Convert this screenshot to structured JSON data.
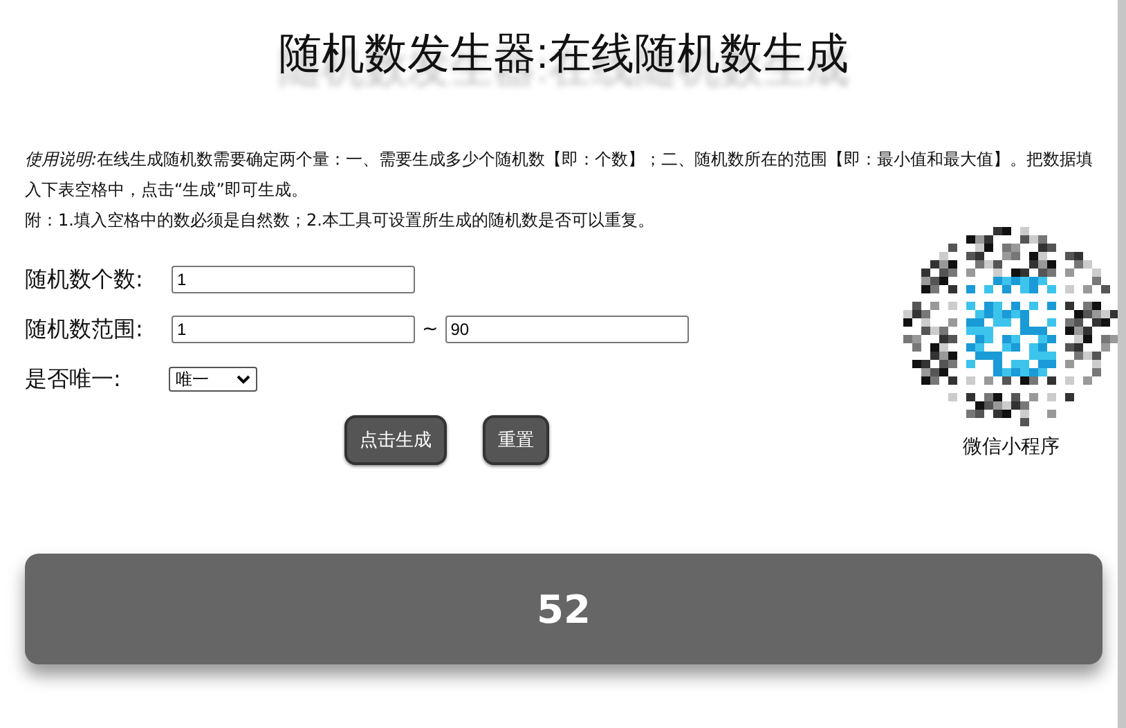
{
  "title": "随机数发生器:在线随机数生成",
  "instructions": {
    "lead": "使用说明:",
    "text": "在线生成随机数需要确定两个量：一、需要生成多少个随机数【即：个数】；二、随机数所在的范围【即：最小值和最大值】。把数据填入下表空格中，点击“生成”即可生成。",
    "note": "附：1.填入空格中的数必须是自然数；2.本工具可设置所生成的随机数是否可以重复。"
  },
  "count": {
    "label": "随机数个数:",
    "value": "1"
  },
  "range": {
    "label": "随机数范围:",
    "min": "1",
    "separator": "~",
    "max": "90"
  },
  "unique": {
    "label": "是否唯一:",
    "value": "唯一"
  },
  "buttons": [
    "点击生成",
    "重置"
  ],
  "qr": {
    "caption": "微信小程序"
  },
  "result": "52"
}
